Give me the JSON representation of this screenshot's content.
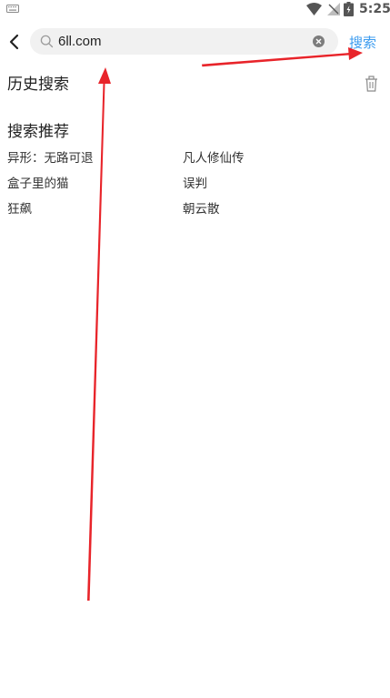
{
  "status_bar": {
    "time": "5:25",
    "icons": [
      "keyboard-icon",
      "wifi-icon",
      "signal-icon",
      "battery-icon"
    ]
  },
  "search": {
    "value": "6ll.com",
    "button_label": "搜索",
    "icons": [
      "back-arrow-icon",
      "search-icon",
      "clear-icon"
    ]
  },
  "history": {
    "title": "历史搜索",
    "icon": "trash-icon"
  },
  "recommend": {
    "title": "搜索推荐",
    "items": [
      [
        "异形：无路可退",
        "凡人修仙传"
      ],
      [
        "盒子里的猫",
        "误判"
      ],
      [
        "狂飙",
        "朝云散"
      ]
    ]
  },
  "colors": {
    "accent": "#3b9bef",
    "annotation": "#e8242a",
    "search_bg": "#f1f1f1",
    "text": "#222222"
  }
}
